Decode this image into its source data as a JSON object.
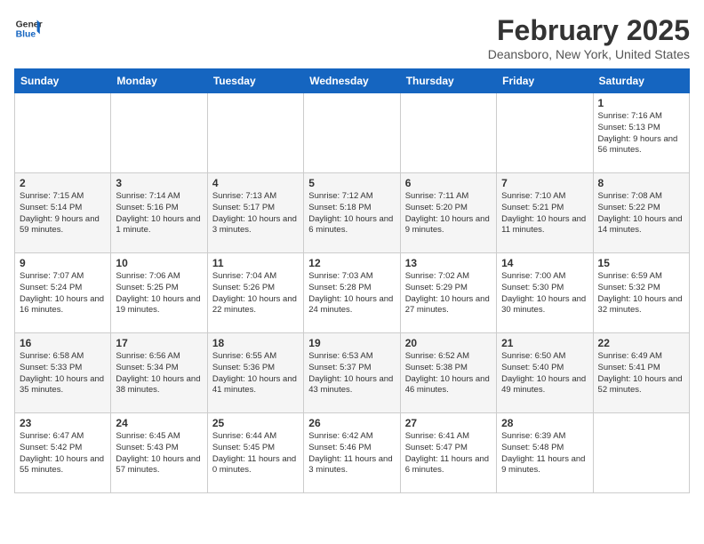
{
  "header": {
    "logo_line1": "General",
    "logo_line2": "Blue",
    "month": "February 2025",
    "location": "Deansboro, New York, United States"
  },
  "days_of_week": [
    "Sunday",
    "Monday",
    "Tuesday",
    "Wednesday",
    "Thursday",
    "Friday",
    "Saturday"
  ],
  "weeks": [
    [
      {
        "day": "",
        "info": ""
      },
      {
        "day": "",
        "info": ""
      },
      {
        "day": "",
        "info": ""
      },
      {
        "day": "",
        "info": ""
      },
      {
        "day": "",
        "info": ""
      },
      {
        "day": "",
        "info": ""
      },
      {
        "day": "1",
        "info": "Sunrise: 7:16 AM\nSunset: 5:13 PM\nDaylight: 9 hours and 56 minutes."
      }
    ],
    [
      {
        "day": "2",
        "info": "Sunrise: 7:15 AM\nSunset: 5:14 PM\nDaylight: 9 hours and 59 minutes."
      },
      {
        "day": "3",
        "info": "Sunrise: 7:14 AM\nSunset: 5:16 PM\nDaylight: 10 hours and 1 minute."
      },
      {
        "day": "4",
        "info": "Sunrise: 7:13 AM\nSunset: 5:17 PM\nDaylight: 10 hours and 3 minutes."
      },
      {
        "day": "5",
        "info": "Sunrise: 7:12 AM\nSunset: 5:18 PM\nDaylight: 10 hours and 6 minutes."
      },
      {
        "day": "6",
        "info": "Sunrise: 7:11 AM\nSunset: 5:20 PM\nDaylight: 10 hours and 9 minutes."
      },
      {
        "day": "7",
        "info": "Sunrise: 7:10 AM\nSunset: 5:21 PM\nDaylight: 10 hours and 11 minutes."
      },
      {
        "day": "8",
        "info": "Sunrise: 7:08 AM\nSunset: 5:22 PM\nDaylight: 10 hours and 14 minutes."
      }
    ],
    [
      {
        "day": "9",
        "info": "Sunrise: 7:07 AM\nSunset: 5:24 PM\nDaylight: 10 hours and 16 minutes."
      },
      {
        "day": "10",
        "info": "Sunrise: 7:06 AM\nSunset: 5:25 PM\nDaylight: 10 hours and 19 minutes."
      },
      {
        "day": "11",
        "info": "Sunrise: 7:04 AM\nSunset: 5:26 PM\nDaylight: 10 hours and 22 minutes."
      },
      {
        "day": "12",
        "info": "Sunrise: 7:03 AM\nSunset: 5:28 PM\nDaylight: 10 hours and 24 minutes."
      },
      {
        "day": "13",
        "info": "Sunrise: 7:02 AM\nSunset: 5:29 PM\nDaylight: 10 hours and 27 minutes."
      },
      {
        "day": "14",
        "info": "Sunrise: 7:00 AM\nSunset: 5:30 PM\nDaylight: 10 hours and 30 minutes."
      },
      {
        "day": "15",
        "info": "Sunrise: 6:59 AM\nSunset: 5:32 PM\nDaylight: 10 hours and 32 minutes."
      }
    ],
    [
      {
        "day": "16",
        "info": "Sunrise: 6:58 AM\nSunset: 5:33 PM\nDaylight: 10 hours and 35 minutes."
      },
      {
        "day": "17",
        "info": "Sunrise: 6:56 AM\nSunset: 5:34 PM\nDaylight: 10 hours and 38 minutes."
      },
      {
        "day": "18",
        "info": "Sunrise: 6:55 AM\nSunset: 5:36 PM\nDaylight: 10 hours and 41 minutes."
      },
      {
        "day": "19",
        "info": "Sunrise: 6:53 AM\nSunset: 5:37 PM\nDaylight: 10 hours and 43 minutes."
      },
      {
        "day": "20",
        "info": "Sunrise: 6:52 AM\nSunset: 5:38 PM\nDaylight: 10 hours and 46 minutes."
      },
      {
        "day": "21",
        "info": "Sunrise: 6:50 AM\nSunset: 5:40 PM\nDaylight: 10 hours and 49 minutes."
      },
      {
        "day": "22",
        "info": "Sunrise: 6:49 AM\nSunset: 5:41 PM\nDaylight: 10 hours and 52 minutes."
      }
    ],
    [
      {
        "day": "23",
        "info": "Sunrise: 6:47 AM\nSunset: 5:42 PM\nDaylight: 10 hours and 55 minutes."
      },
      {
        "day": "24",
        "info": "Sunrise: 6:45 AM\nSunset: 5:43 PM\nDaylight: 10 hours and 57 minutes."
      },
      {
        "day": "25",
        "info": "Sunrise: 6:44 AM\nSunset: 5:45 PM\nDaylight: 11 hours and 0 minutes."
      },
      {
        "day": "26",
        "info": "Sunrise: 6:42 AM\nSunset: 5:46 PM\nDaylight: 11 hours and 3 minutes."
      },
      {
        "day": "27",
        "info": "Sunrise: 6:41 AM\nSunset: 5:47 PM\nDaylight: 11 hours and 6 minutes."
      },
      {
        "day": "28",
        "info": "Sunrise: 6:39 AM\nSunset: 5:48 PM\nDaylight: 11 hours and 9 minutes."
      },
      {
        "day": "",
        "info": ""
      }
    ]
  ]
}
